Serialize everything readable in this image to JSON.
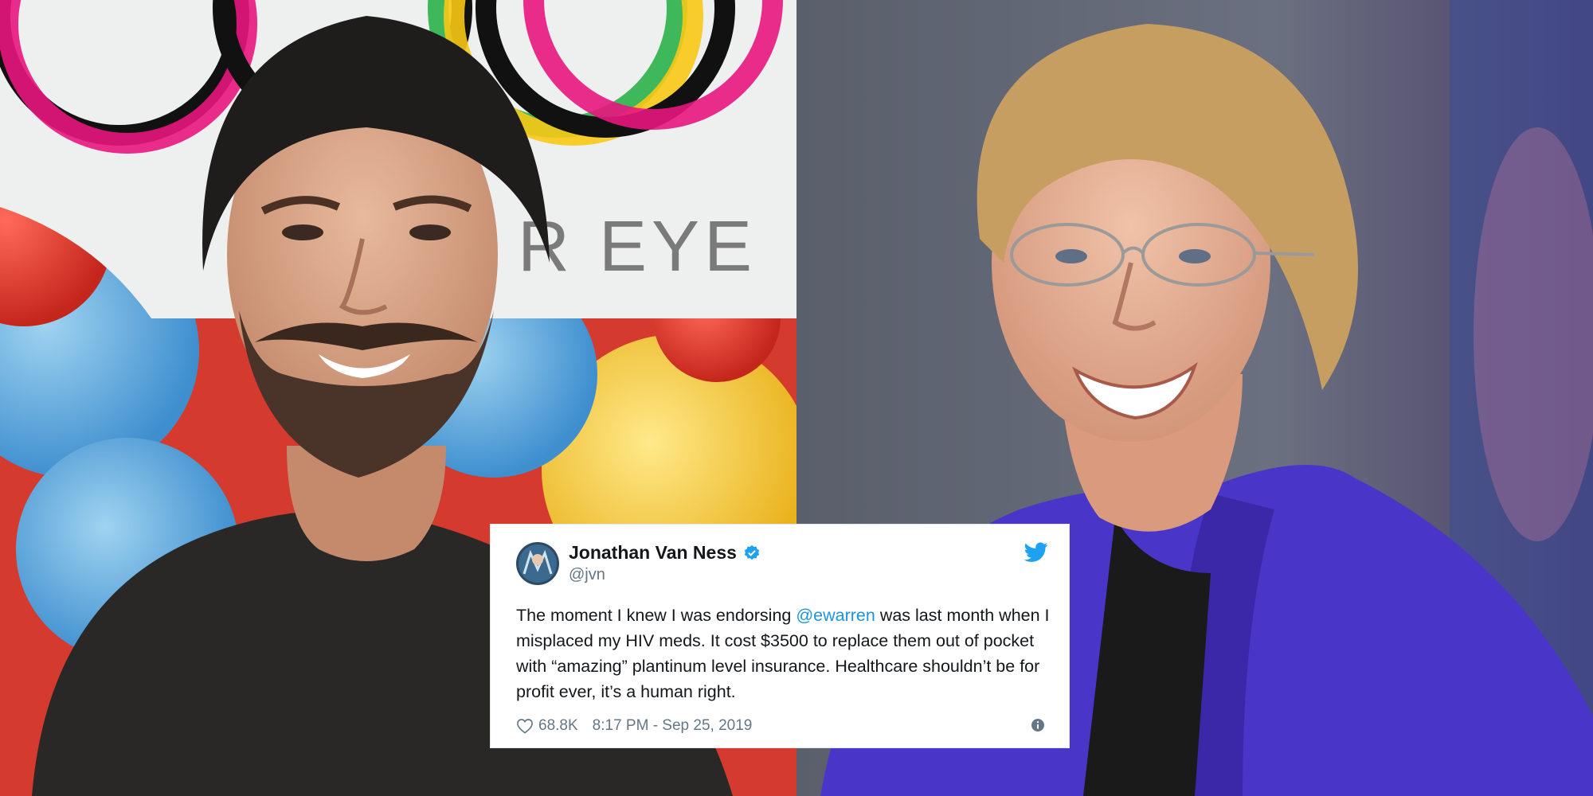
{
  "photos": {
    "left_sign_text": "R EYE"
  },
  "tweet": {
    "display_name": "Jonathan Van Ness",
    "handle": "@jvn",
    "text_before_mention": "The moment I knew I was endorsing ",
    "mention": "@ewarren",
    "text_after_mention": " was last month when I misplaced my HIV meds. It cost $3500 to replace them out of pocket with “amazing” plantinum level insurance. Healthcare shouldn’t be for profit ever, it’s a human right.",
    "likes": "68.8K",
    "timestamp": "8:17 PM - Sep 25, 2019",
    "icons": [
      "avatar",
      "verified-badge-icon",
      "twitter-bird-icon",
      "heart-icon",
      "info-icon"
    ],
    "colors": {
      "link": "#1b95e0",
      "text": "#14171a",
      "muted": "#657786"
    }
  }
}
